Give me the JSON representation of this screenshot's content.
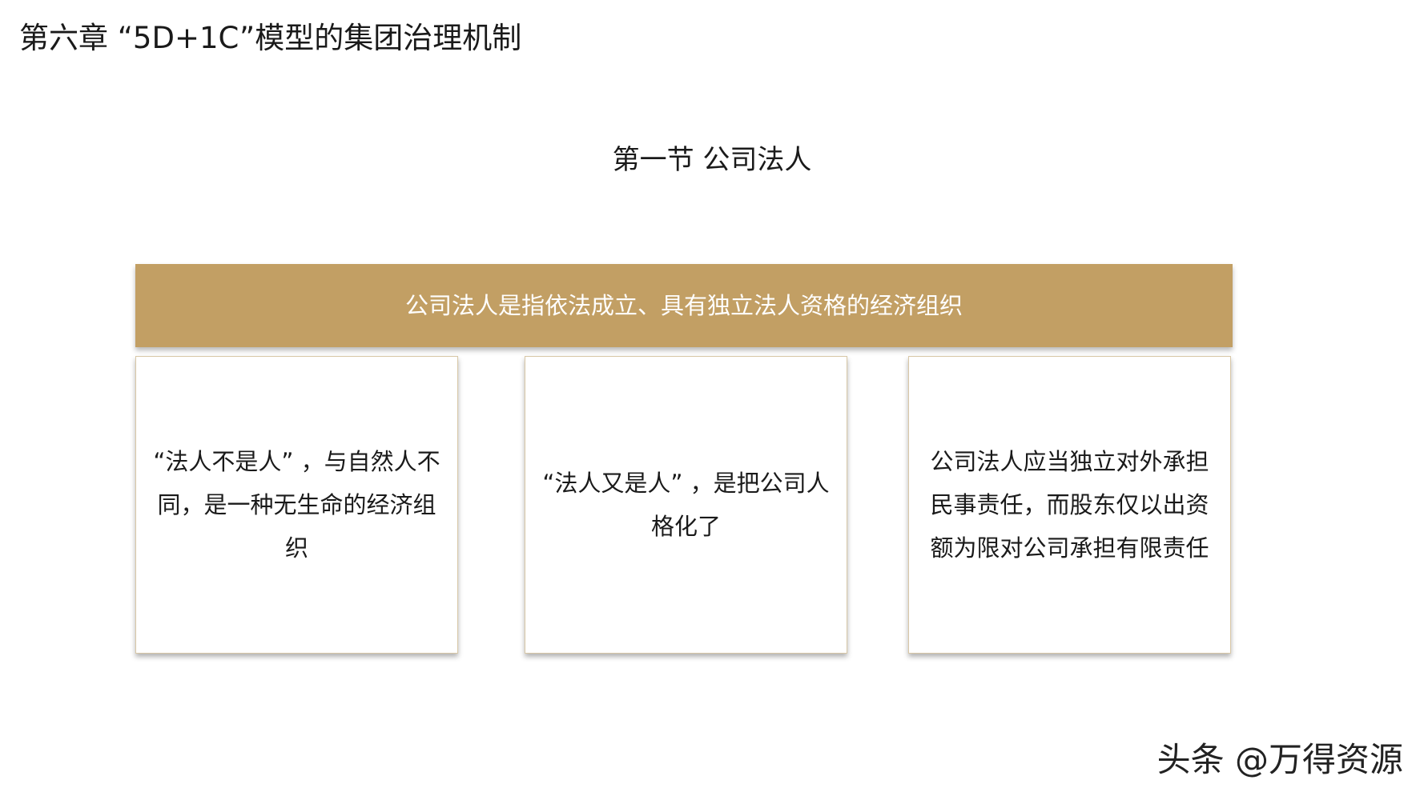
{
  "chapter": {
    "title": "第六章 “5D+1C”模型的集团治理机制"
  },
  "section": {
    "title": "第一节 公司法人"
  },
  "definition": {
    "text": "公司法人是指依法成立、具有独立法人资格的经济组织"
  },
  "cards": [
    {
      "text": "“法人不是人” ，与自然人不同，是一种无生命的经济组织"
    },
    {
      "text": "“法人又是人” ，是把公司人格化了"
    },
    {
      "text": "公司法人应当独立对外承担民事责任，而股东仅以出资额为限对公司承担有限责任"
    }
  ],
  "watermark": {
    "text": "头条 @万得资源"
  },
  "colors": {
    "accent": "#c29f64",
    "card_border": "#d8c7a6",
    "text": "#1a1a1a"
  }
}
